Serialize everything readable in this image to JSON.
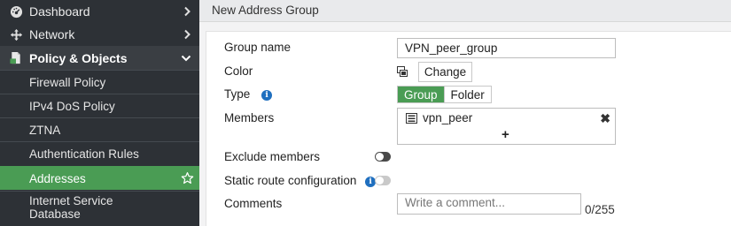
{
  "sidebar": {
    "top_items": [
      {
        "label": "Dashboard",
        "icon": "dashboard-icon"
      },
      {
        "label": "Network",
        "icon": "network-icon"
      },
      {
        "label": "Policy & Objects",
        "icon": "policy-icon",
        "expanded": true
      }
    ],
    "sub_items": [
      {
        "label": "Firewall Policy"
      },
      {
        "label": "IPv4 DoS Policy"
      },
      {
        "label": "ZTNA"
      },
      {
        "label": "Authentication Rules"
      },
      {
        "label": "Addresses",
        "active": true
      },
      {
        "label": "Internet Service Database"
      }
    ]
  },
  "header": {
    "title": "New Address Group"
  },
  "form": {
    "group_name_label": "Group name",
    "group_name_value": "VPN_peer_group",
    "color_label": "Color",
    "color_change_button": "Change",
    "type_label": "Type",
    "type_options": [
      "Group",
      "Folder"
    ],
    "type_selected": "Group",
    "members_label": "Members",
    "members": [
      {
        "name": "vpn_peer"
      }
    ],
    "add_symbol": "+",
    "remove_symbol": "✖",
    "exclude_members_label": "Exclude members",
    "exclude_members_enabled": false,
    "static_route_label": "Static route configuration",
    "static_route_enabled": false,
    "comments_label": "Comments",
    "comments_placeholder": "Write a comment...",
    "comments_counter": "0/255"
  },
  "colors": {
    "sidebar_bg": "#2d3136",
    "accent_green": "#4a9c54",
    "info_blue": "#1f6fbf"
  }
}
